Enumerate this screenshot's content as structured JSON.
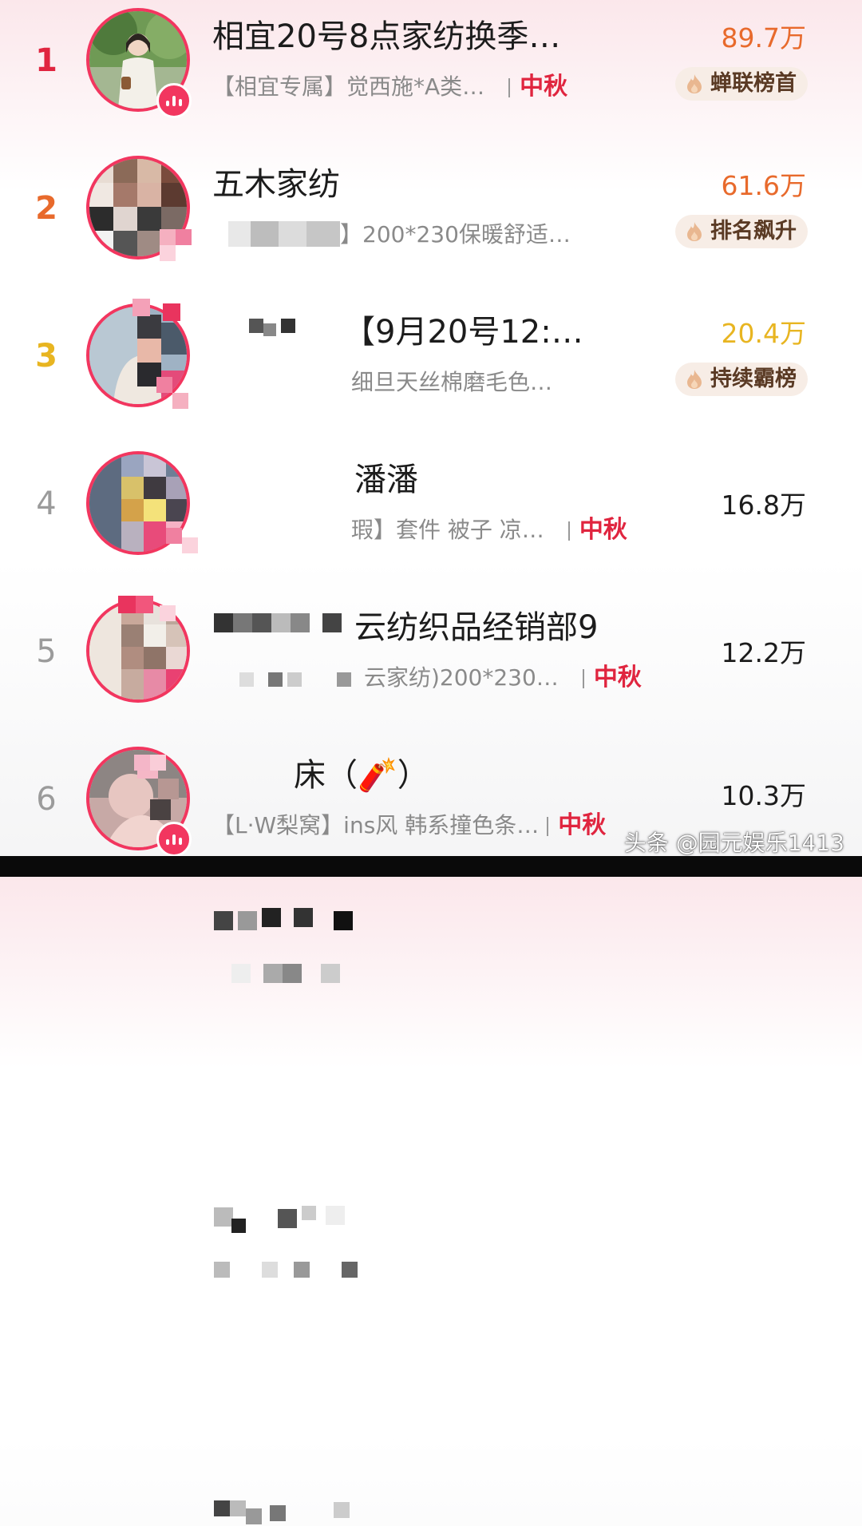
{
  "colors": {
    "rank1": "#e0253f",
    "rank2": "#e86a2c",
    "rank3": "#e8b521",
    "rank_other": "#9b9b9b",
    "accent": "#f2365f",
    "amount_hot": "#e86a2c",
    "amount_third": "#e8b521"
  },
  "items": [
    {
      "rank": "1",
      "title": "相宜20号8点家纺换季…",
      "subtitle": "【相宜专属】觉西施*A类…",
      "tag": "中秋",
      "amount": "89.7万",
      "badge": "蝉联榜首"
    },
    {
      "rank": "2",
      "title": "五木家纺",
      "subtitle": "】200*230保暖舒适…",
      "tag": "",
      "amount": "61.6万",
      "badge": "排名飙升"
    },
    {
      "rank": "3",
      "title": "【9月20号12:…",
      "subtitle": "细旦天丝棉磨毛色…",
      "tag": "",
      "amount": "20.4万",
      "badge": "持续霸榜"
    },
    {
      "rank": "4",
      "title": "潘潘",
      "subtitle": "瑕】套件 被子 凉…",
      "tag": "中秋",
      "amount": "16.8万",
      "badge": ""
    },
    {
      "rank": "5",
      "title": "云纺织品经销部9",
      "subtitle": "云家纺)200*230…",
      "tag": "中秋",
      "amount": "12.2万",
      "badge": ""
    },
    {
      "rank": "6",
      "title": "床（🧨）",
      "subtitle": "【L·W梨窝】ins风 韩系撞色条…",
      "tag": "中秋",
      "amount": "10.3万",
      "badge": ""
    }
  ],
  "watermark": "头条 @园元娱乐1413"
}
